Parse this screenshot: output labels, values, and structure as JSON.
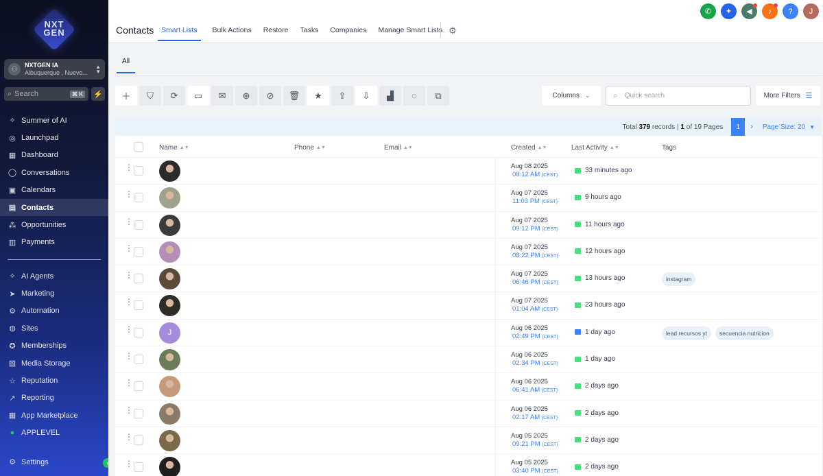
{
  "brand": {
    "logo_text": "NXT GEN"
  },
  "account": {
    "name": "NXTGEN IA",
    "location": "Albuquerque , Nuevo..."
  },
  "sidebar_search": {
    "placeholder": "Search",
    "shortcut": "⌘ K"
  },
  "nav": {
    "primary": [
      {
        "label": "Summer of AI",
        "icon": "sparkles-icon",
        "glyph": "✧"
      },
      {
        "label": "Launchpad",
        "icon": "rocket-icon",
        "glyph": "◎"
      },
      {
        "label": "Dashboard",
        "icon": "dashboard-icon",
        "glyph": "▦"
      },
      {
        "label": "Conversations",
        "icon": "chat-icon",
        "glyph": "◯"
      },
      {
        "label": "Calendars",
        "icon": "calendar-icon",
        "glyph": "▣"
      },
      {
        "label": "Contacts",
        "icon": "contacts-icon",
        "glyph": "▤",
        "active": true
      },
      {
        "label": "Opportunities",
        "icon": "opportunities-icon",
        "glyph": "⁂"
      },
      {
        "label": "Payments",
        "icon": "payments-icon",
        "glyph": "▥"
      }
    ],
    "secondary": [
      {
        "label": "AI Agents",
        "icon": "sparkles-icon",
        "glyph": "✧"
      },
      {
        "label": "Marketing",
        "icon": "send-icon",
        "glyph": "➤"
      },
      {
        "label": "Automation",
        "icon": "automation-icon",
        "glyph": "⚙"
      },
      {
        "label": "Sites",
        "icon": "globe-icon",
        "glyph": "◍"
      },
      {
        "label": "Memberships",
        "icon": "award-icon",
        "glyph": "✪"
      },
      {
        "label": "Media Storage",
        "icon": "image-icon",
        "glyph": "▨"
      },
      {
        "label": "Reputation",
        "icon": "star-icon",
        "glyph": "☆"
      },
      {
        "label": "Reporting",
        "icon": "trend-icon",
        "glyph": "↗"
      },
      {
        "label": "App Marketplace",
        "icon": "grid-icon",
        "glyph": "▦"
      },
      {
        "label": "APPLEVEL",
        "icon": "whatsapp-icon",
        "glyph": "●"
      }
    ],
    "settings": {
      "label": "Settings",
      "icon": "gear-icon",
      "glyph": "⚙"
    }
  },
  "header": {
    "title": "Contacts",
    "tabs": [
      "Smart Lists",
      "Bulk Actions",
      "Restore",
      "Tasks",
      "Companies",
      "Manage Smart Lists"
    ],
    "active_tab": "Smart Lists"
  },
  "top_icons": [
    {
      "name": "phone-icon",
      "color": "#16a34a",
      "glyph": "✆"
    },
    {
      "name": "magic-icon",
      "color": "#2563eb",
      "glyph": "✦"
    },
    {
      "name": "megaphone-icon",
      "color": "#4b7a6a",
      "glyph": "◀"
    },
    {
      "name": "bell-icon",
      "color": "#f97316",
      "glyph": "♪"
    },
    {
      "name": "help-icon",
      "color": "#3b82f6",
      "glyph": "?"
    },
    {
      "name": "user-avatar",
      "color": "#b66a5e",
      "glyph": "J"
    }
  ],
  "subtabs": {
    "all": "All"
  },
  "toolbar": {
    "columns_label": "Columns",
    "search_placeholder": "Quick search",
    "more_filters_label": "More Filters"
  },
  "pager": {
    "total_prefix": "Total",
    "total": "379",
    "records_text": "records |",
    "page": "1",
    "of_text": "of 19 Pages",
    "current_page": "1",
    "page_size_label": "Page Size: 20"
  },
  "columns": {
    "name": "Name",
    "phone": "Phone",
    "email": "Email",
    "created": "Created",
    "last_activity": "Last Activity",
    "tags": "Tags"
  },
  "rows": [
    {
      "date": "Aug 08 2025",
      "time": "08:12 AM",
      "tz": "(CEST)",
      "activity": "33 minutes ago",
      "activity_type": "sms",
      "avatar_color": "#2b2b2b",
      "tags": []
    },
    {
      "date": "Aug 07 2025",
      "time": "11:03 PM",
      "tz": "(CEST)",
      "activity": "9 hours ago",
      "activity_type": "sms",
      "avatar_color": "#9ca38a",
      "tags": []
    },
    {
      "date": "Aug 07 2025",
      "time": "09:12 PM",
      "tz": "(CEST)",
      "activity": "11 hours ago",
      "activity_type": "sms",
      "avatar_color": "#3a3a3a",
      "tags": []
    },
    {
      "date": "Aug 07 2025",
      "time": "08:22 PM",
      "tz": "(CEST)",
      "activity": "12 hours ago",
      "activity_type": "sms",
      "avatar_color": "#b48fb5",
      "tags": []
    },
    {
      "date": "Aug 07 2025",
      "time": "06:46 PM",
      "tz": "(CEST)",
      "activity": "13 hours ago",
      "activity_type": "sms",
      "avatar_color": "#5a4a3a",
      "tags": [
        "instagram"
      ]
    },
    {
      "date": "Aug 07 2025",
      "time": "01:04 AM",
      "tz": "(CEST)",
      "activity": "23 hours ago",
      "activity_type": "sms",
      "avatar_color": "#2e2a26",
      "tags": []
    },
    {
      "date": "Aug 06 2025",
      "time": "02:49 PM",
      "tz": "(CEST)",
      "activity": "1 day ago",
      "activity_type": "email",
      "avatar_letter": "J",
      "avatar_color": "#a78bdb",
      "tags": [
        "lead recursos yt",
        "secuencia nutricion"
      ]
    },
    {
      "date": "Aug 06 2025",
      "time": "02:34 PM",
      "tz": "(CEST)",
      "activity": "1 day ago",
      "activity_type": "sms",
      "avatar_color": "#6b7c5a",
      "tags": []
    },
    {
      "date": "Aug 06 2025",
      "time": "06:41 AM",
      "tz": "(CEST)",
      "activity": "2 days ago",
      "activity_type": "sms",
      "avatar_color": "#c49a7a",
      "tags": []
    },
    {
      "date": "Aug 06 2025",
      "time": "02:17 AM",
      "tz": "(CEST)",
      "activity": "2 days ago",
      "activity_type": "sms",
      "avatar_color": "#8a7a6a",
      "tags": []
    },
    {
      "date": "Aug 05 2025",
      "time": "09:21 PM",
      "tz": "(CEST)",
      "activity": "2 days ago",
      "activity_type": "sms",
      "avatar_color": "#7a6a4a",
      "tags": []
    },
    {
      "date": "Aug 05 2025",
      "time": "03:40 PM",
      "tz": "(CEST)",
      "activity": "2 days ago",
      "activity_type": "sms",
      "avatar_color": "#1f1f1f",
      "tags": []
    }
  ]
}
